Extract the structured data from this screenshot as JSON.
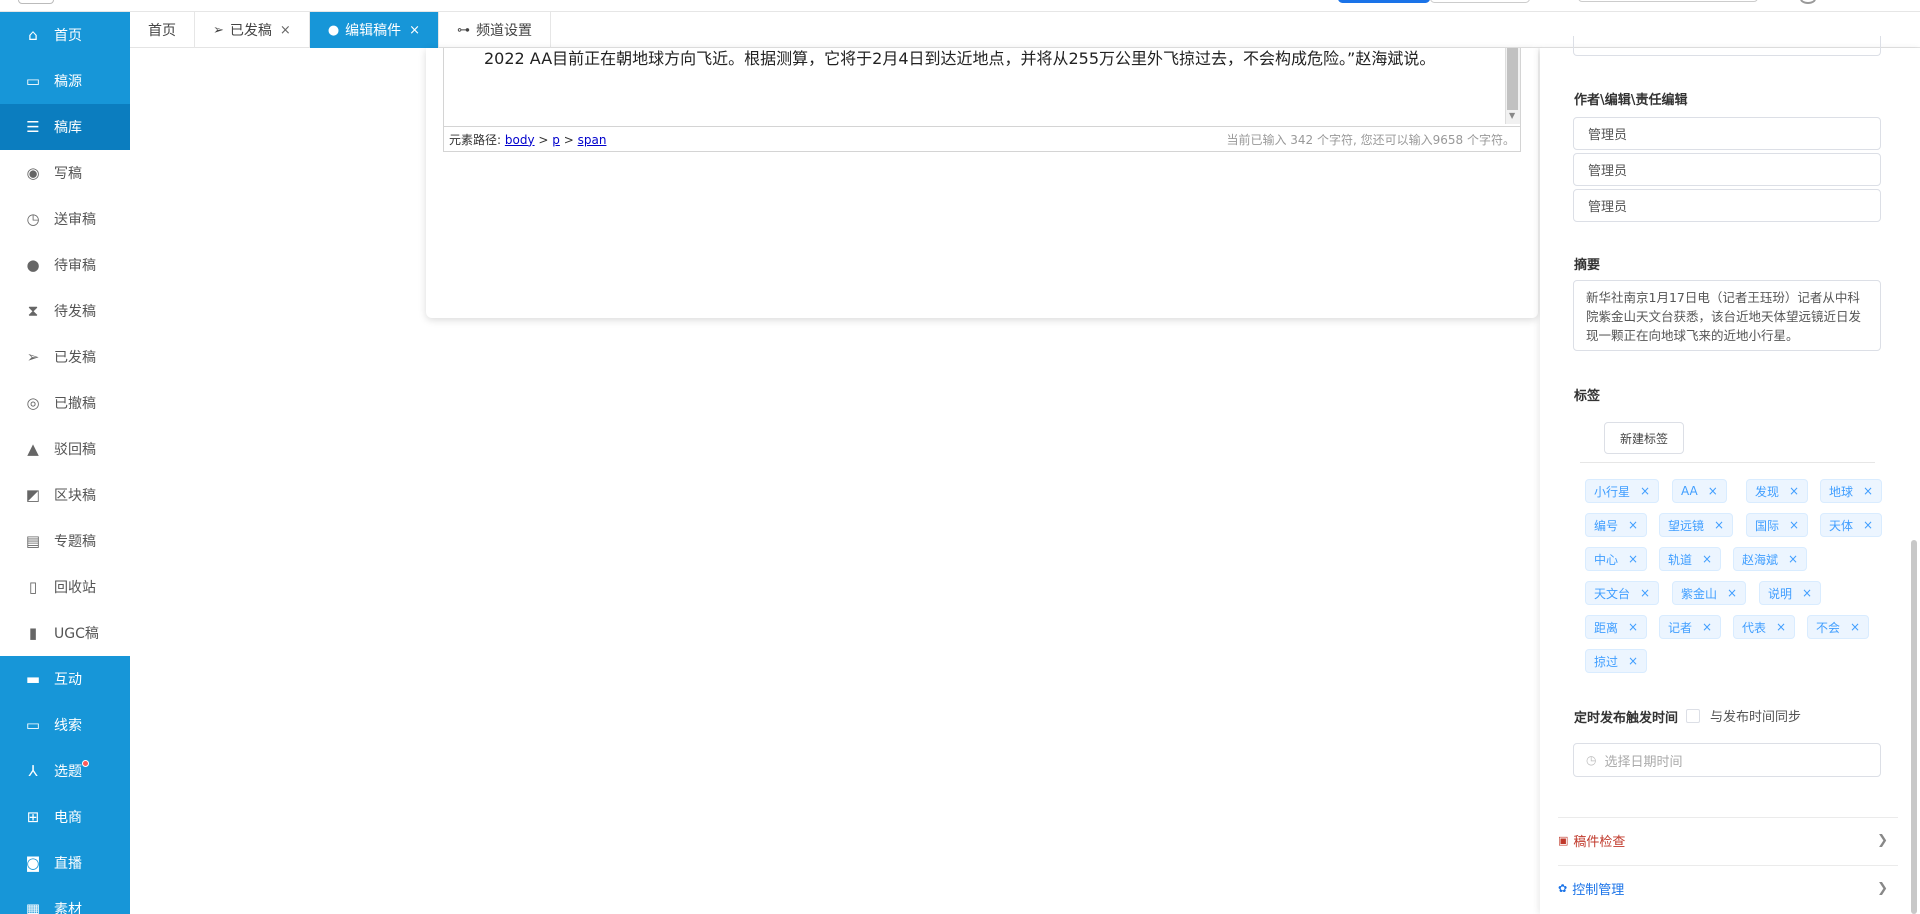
{
  "sidebar": {
    "items": [
      {
        "label": "首页",
        "icon": "home-icon",
        "glyph": "⌂",
        "style": "blue"
      },
      {
        "label": "稿源",
        "icon": "monitor-icon",
        "glyph": "▭",
        "style": "blue"
      },
      {
        "label": "稿库",
        "icon": "database-icon",
        "glyph": "☰",
        "style": "active"
      },
      {
        "label": "写稿",
        "icon": "user-circle-icon",
        "glyph": "◉",
        "style": ""
      },
      {
        "label": "送审稿",
        "icon": "clock-icon",
        "glyph": "◷",
        "style": ""
      },
      {
        "label": "待审稿",
        "icon": "alert-circle-icon",
        "glyph": "●",
        "style": ""
      },
      {
        "label": "待发稿",
        "icon": "hourglass-icon",
        "glyph": "⧗",
        "style": ""
      },
      {
        "label": "已发稿",
        "icon": "paper-plane-icon",
        "glyph": "➢",
        "style": ""
      },
      {
        "label": "已撤稿",
        "icon": "eye-slash-icon",
        "glyph": "◎",
        "style": ""
      },
      {
        "label": "驳回稿",
        "icon": "warning-icon",
        "glyph": "▲",
        "style": ""
      },
      {
        "label": "区块稿",
        "icon": "rss-icon",
        "glyph": "◩",
        "style": ""
      },
      {
        "label": "专题稿",
        "icon": "newspaper-icon",
        "glyph": "▤",
        "style": ""
      },
      {
        "label": "回收站",
        "icon": "trash-icon",
        "glyph": "▯",
        "style": ""
      },
      {
        "label": "UGC稿",
        "icon": "file-icon",
        "glyph": "▮",
        "style": ""
      },
      {
        "label": "互动",
        "icon": "chat-icon",
        "glyph": "▬",
        "style": "blue"
      },
      {
        "label": "线索",
        "icon": "monitor-icon",
        "glyph": "▭",
        "style": "blue"
      },
      {
        "label": "选题",
        "icon": "topic-icon",
        "glyph": "⅄",
        "style": "blue",
        "dot": true
      },
      {
        "label": "电商",
        "icon": "cart-icon",
        "glyph": "⊞",
        "style": "blue"
      },
      {
        "label": "直播",
        "icon": "video-icon",
        "glyph": "◙",
        "style": "blue"
      },
      {
        "label": "素材",
        "icon": "image-icon",
        "glyph": "▦",
        "style": "blue"
      }
    ]
  },
  "tabs": [
    {
      "label": "首页",
      "icon": "",
      "closable": false,
      "active": false
    },
    {
      "label": "已发稿",
      "icon": "➢",
      "closable": true,
      "active": false
    },
    {
      "label": "编辑稿件",
      "icon": "●",
      "closable": true,
      "active": true
    },
    {
      "label": "频道设置",
      "icon": "⊶",
      "closable": false,
      "active": false
    }
  ],
  "editor": {
    "text": "2022 AA目前正在朝地球方向飞近。根据测算，它将于2月4日到达近地点，并将从255万公里外飞掠过去，不会构成危险。”赵海斌说。",
    "path_label": "元素路径:",
    "path": [
      "body",
      "p",
      "span"
    ],
    "count_text": "当前已输入 342 个字符, 您还可以输入9658 个字符。"
  },
  "panel": {
    "authors_label": "作者\\编辑\\责任编辑",
    "author": "管理员",
    "editor": "管理员",
    "chief_editor": "管理员",
    "summary_label": "摘要",
    "summary": "新华社南京1月17日电（记者王珏玢）记者从中科院紫金山天文台获悉，该台近地天体望远镜近日发现一颗正在向地球飞来的近地小行星。",
    "tags_label": "标签",
    "new_tag_button": "新建标签",
    "tags": [
      [
        "小行星",
        "AA",
        "发现",
        "地球"
      ],
      [
        "编号",
        "望远镜",
        "国际",
        "天体"
      ],
      [
        "中心",
        "轨道",
        "赵海斌"
      ],
      [
        "天文台",
        "紫金山",
        "说明"
      ],
      [
        "距离",
        "记者",
        "代表",
        "不会"
      ],
      [
        "掠过"
      ]
    ],
    "schedule_label": "定时发布触发时间",
    "sync_label": "与发布时间同步",
    "date_placeholder": "选择日期时间",
    "check_label": "稿件检查",
    "control_label": "控制管理",
    "check_color": "#c0392b",
    "control_color": "#1a73e8"
  }
}
